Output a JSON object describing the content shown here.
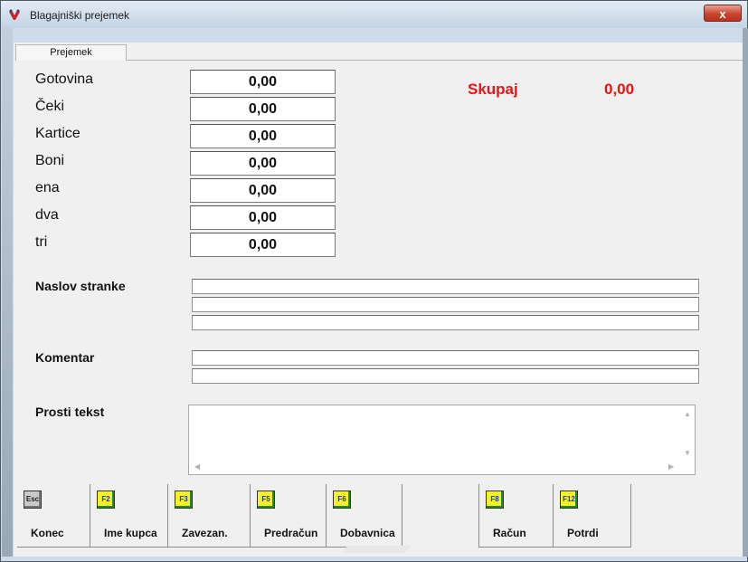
{
  "window": {
    "title": "Blagajniški prejemek",
    "close_label": "x"
  },
  "tabs": [
    {
      "label": "Prejemek"
    }
  ],
  "payments": [
    {
      "label": "Gotovina",
      "value": "0,00"
    },
    {
      "label": "Čeki",
      "value": "0,00"
    },
    {
      "label": "Kartice",
      "value": "0,00"
    },
    {
      "label": "Boni",
      "value": "0,00"
    },
    {
      "label": "ena",
      "value": "0,00"
    },
    {
      "label": "dva",
      "value": "0,00"
    },
    {
      "label": "tri",
      "value": "0,00"
    }
  ],
  "total": {
    "label": "Skupaj",
    "value": "0,00",
    "color": "#e81414"
  },
  "address": {
    "label": "Naslov stranke",
    "lines": [
      "",
      "",
      ""
    ]
  },
  "comment": {
    "label": "Komentar",
    "lines": [
      "",
      ""
    ]
  },
  "free_text": {
    "label": "Prosti tekst",
    "value": ""
  },
  "toolbar": {
    "buttons": [
      {
        "key": "Esc",
        "label": "Konec"
      },
      {
        "key": "F2",
        "label": "Ime kupca"
      },
      {
        "key": "F3",
        "label": "Zavezan."
      },
      {
        "key": "F5",
        "label": "Predračun"
      },
      {
        "key": "F6",
        "label": "Dobavnica"
      },
      {
        "key": "F8",
        "label": "Račun"
      },
      {
        "key": "F12",
        "label": "Potrdi"
      }
    ]
  },
  "colors": {
    "key_yellow": "#f4f222",
    "key_gray": "#c9c9c9",
    "accent_red": "#e81414"
  }
}
